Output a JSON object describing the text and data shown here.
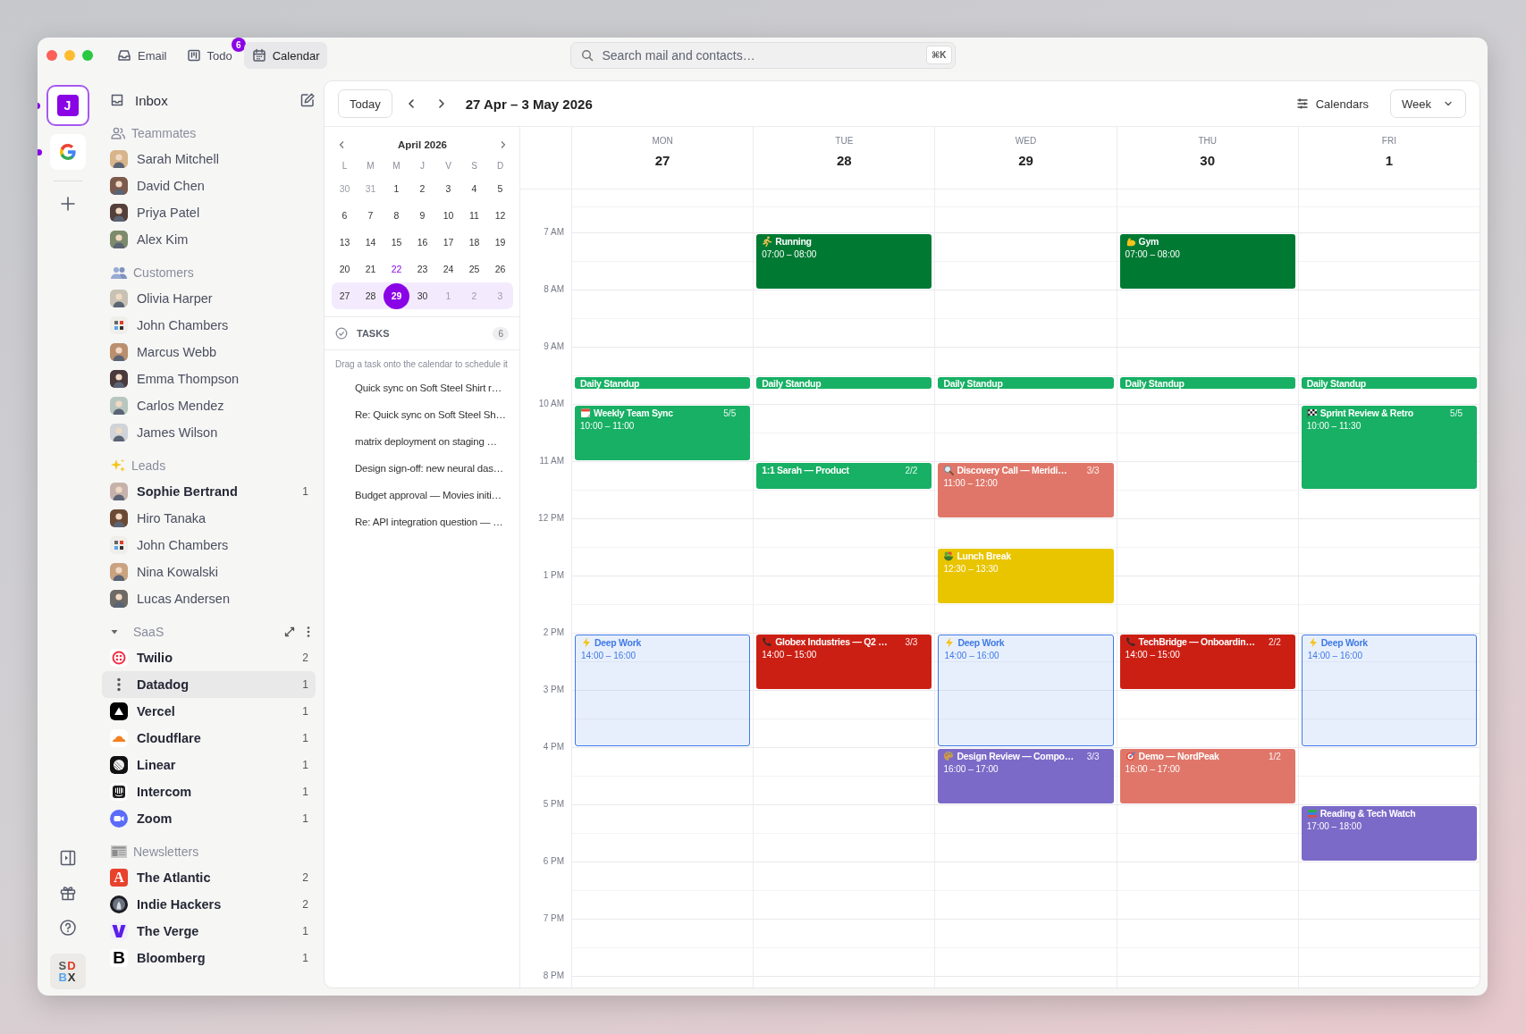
{
  "top_tabs": [
    {
      "label": "Email",
      "selected": false
    },
    {
      "label": "Todo",
      "selected": false,
      "badge": "6"
    },
    {
      "label": "Calendar",
      "selected": true
    }
  ],
  "search": {
    "placeholder": "Search mail and contacts…",
    "shortcut": "⌘K"
  },
  "rail": {
    "accounts": [
      {
        "kind": "letter",
        "label": "J",
        "selected": true,
        "unread": true
      },
      {
        "kind": "google",
        "selected": false,
        "unread": true
      }
    ],
    "workspace_badge": [
      "SD",
      "BX"
    ]
  },
  "sidebar": {
    "inbox": "Inbox",
    "sections": [
      {
        "kind": "teammates",
        "title": "Teammates",
        "items": [
          {
            "kind": "person",
            "name": "Sarah Mitchell",
            "selected": false
          },
          {
            "kind": "person",
            "name": "David Chen",
            "selected": false
          },
          {
            "kind": "person",
            "name": "Priya Patel",
            "selected": false
          },
          {
            "kind": "person",
            "name": "Alex Kim",
            "selected": false
          }
        ]
      },
      {
        "kind": "customers",
        "title": "Customers",
        "items": [
          {
            "kind": "person",
            "name": "Olivia Harper",
            "selected": false
          },
          {
            "kind": "logo",
            "name": "John Chambers",
            "selected": false
          },
          {
            "kind": "person",
            "name": "Marcus Webb",
            "selected": false
          },
          {
            "kind": "person",
            "name": "Emma Thompson",
            "selected": false
          },
          {
            "kind": "person",
            "name": "Carlos Mendez",
            "selected": false
          },
          {
            "kind": "person",
            "name": "James Wilson",
            "selected": false
          }
        ]
      },
      {
        "kind": "leads",
        "title": "Leads",
        "items": [
          {
            "kind": "person",
            "name": "Sophie Bertrand",
            "count": "1",
            "selected": false
          },
          {
            "kind": "person",
            "name": "Hiro Tanaka",
            "selected": false
          },
          {
            "kind": "logo",
            "name": "John Chambers",
            "selected": false
          },
          {
            "kind": "person",
            "name": "Nina Kowalski",
            "selected": false
          },
          {
            "kind": "person",
            "name": "Lucas Andersen",
            "selected": false
          }
        ]
      },
      {
        "kind": "saas",
        "title": "SaaS",
        "toggle": {
          "expanded": true
        },
        "items": [
          {
            "kind": "brand",
            "name": "Twilio",
            "count": "2",
            "selected": false
          },
          {
            "kind": "brand",
            "name": "Datadog",
            "count": "1",
            "selected": true
          },
          {
            "kind": "brand",
            "name": "Vercel",
            "count": "1",
            "selected": false
          },
          {
            "kind": "brand",
            "name": "Cloudflare",
            "count": "1",
            "selected": false
          },
          {
            "kind": "brand",
            "name": "Linear",
            "count": "1",
            "selected": false
          },
          {
            "kind": "brand",
            "name": "Intercom",
            "count": "1",
            "selected": false
          },
          {
            "kind": "brand",
            "name": "Zoom",
            "count": "1",
            "selected": false
          }
        ]
      },
      {
        "kind": "newsletters",
        "title": "Newsletters",
        "items": [
          {
            "kind": "brand",
            "name": "The Atlantic",
            "logo_letter": "A",
            "count": "2",
            "selected": false
          },
          {
            "kind": "brand",
            "name": "Indie Hackers",
            "count": "2",
            "selected": false
          },
          {
            "kind": "brand",
            "name": "The Verge",
            "count": "1",
            "selected": false
          },
          {
            "kind": "brand",
            "name": "Bloomberg",
            "logo_letter": "B",
            "count": "1",
            "selected": false
          }
        ]
      }
    ]
  },
  "toolbar": {
    "today": "Today",
    "range": "27 Apr – 3 May 2026",
    "calendars": "Calendars",
    "view": "Week"
  },
  "mini_calendar": {
    "title": "April 2026",
    "weekdays": [
      "L",
      "M",
      "M",
      "J",
      "V",
      "S",
      "D"
    ],
    "weeks": [
      {
        "in_range": false,
        "days": [
          {
            "label": "30",
            "muted": true,
            "today": false,
            "selected": false
          },
          {
            "label": "31",
            "muted": true,
            "today": false,
            "selected": false
          },
          {
            "label": "1",
            "muted": false,
            "today": false,
            "selected": false
          },
          {
            "label": "2",
            "muted": false,
            "today": false,
            "selected": false
          },
          {
            "label": "3",
            "muted": false,
            "today": false,
            "selected": false
          },
          {
            "label": "4",
            "muted": false,
            "today": false,
            "selected": false
          },
          {
            "label": "5",
            "muted": false,
            "today": false,
            "selected": false
          }
        ]
      },
      {
        "in_range": false,
        "days": [
          {
            "label": "6",
            "muted": false,
            "today": false,
            "selected": false
          },
          {
            "label": "7",
            "muted": false,
            "today": false,
            "selected": false
          },
          {
            "label": "8",
            "muted": false,
            "today": false,
            "selected": false
          },
          {
            "label": "9",
            "muted": false,
            "today": false,
            "selected": false
          },
          {
            "label": "10",
            "muted": false,
            "today": false,
            "selected": false
          },
          {
            "label": "11",
            "muted": false,
            "today": false,
            "selected": false
          },
          {
            "label": "12",
            "muted": false,
            "today": false,
            "selected": false
          }
        ]
      },
      {
        "in_range": false,
        "days": [
          {
            "label": "13",
            "muted": false,
            "today": false,
            "selected": false
          },
          {
            "label": "14",
            "muted": false,
            "today": false,
            "selected": false
          },
          {
            "label": "15",
            "muted": false,
            "today": false,
            "selected": false
          },
          {
            "label": "16",
            "muted": false,
            "today": false,
            "selected": false
          },
          {
            "label": "17",
            "muted": false,
            "today": false,
            "selected": false
          },
          {
            "label": "18",
            "muted": false,
            "today": false,
            "selected": false
          },
          {
            "label": "19",
            "muted": false,
            "today": false,
            "selected": false
          }
        ]
      },
      {
        "in_range": false,
        "days": [
          {
            "label": "20",
            "muted": false,
            "today": false,
            "selected": false
          },
          {
            "label": "21",
            "muted": false,
            "today": false,
            "selected": false
          },
          {
            "label": "22",
            "muted": false,
            "today": true,
            "selected": false
          },
          {
            "label": "23",
            "muted": false,
            "today": false,
            "selected": false
          },
          {
            "label": "24",
            "muted": false,
            "today": false,
            "selected": false
          },
          {
            "label": "25",
            "muted": false,
            "today": false,
            "selected": false
          },
          {
            "label": "26",
            "muted": false,
            "today": false,
            "selected": false
          }
        ]
      },
      {
        "in_range": true,
        "days": [
          {
            "label": "27",
            "muted": false,
            "today": false,
            "selected": false
          },
          {
            "label": "28",
            "muted": false,
            "today": false,
            "selected": false
          },
          {
            "label": "29",
            "muted": false,
            "today": false,
            "selected": true
          },
          {
            "label": "30",
            "muted": false,
            "today": false,
            "selected": false
          },
          {
            "label": "1",
            "muted": true,
            "today": false,
            "selected": false
          },
          {
            "label": "2",
            "muted": true,
            "today": false,
            "selected": false
          },
          {
            "label": "3",
            "muted": true,
            "today": false,
            "selected": false
          }
        ]
      }
    ]
  },
  "tasks": {
    "title": "TASKS",
    "count": "6",
    "hint": "Drag a task onto the calendar to schedule it",
    "items": [
      "Quick sync on Soft Steel Shirt r…",
      "Re: Quick sync on Soft Steel Sh…",
      "matrix deployment on staging …",
      "Design sign-off: new neural das…",
      "Budget approval — Movies initi…",
      "Re: API integration question — …"
    ]
  },
  "week": {
    "hours": [
      "7 AM",
      "8 AM",
      "9 AM",
      "10 AM",
      "11 AM",
      "12 PM",
      "1 PM",
      "2 PM",
      "3 PM",
      "4 PM",
      "5 PM",
      "6 PM",
      "7 PM",
      "8 PM"
    ],
    "days": [
      {
        "weekday": "MON",
        "date": "27",
        "events": [
          {
            "kind": "solid",
            "title": "Daily Standup",
            "placed_at": {
              "09:30-09:45": true
            },
            "color": "#17b064"
          },
          {
            "kind": "solid",
            "title": "Weekly Team Sync",
            "count": "5/5",
            "time": "10:00 – 11:00",
            "color": "#17b064"
          },
          {
            "kind": "outline",
            "title": "Deep Work",
            "time": "14:00 – 16:00",
            "color": "#3f7ae6"
          }
        ]
      },
      {
        "weekday": "TUE",
        "date": "28",
        "events": [
          {
            "kind": "solid",
            "title": "Running",
            "time": "07:00 – 08:00",
            "color": "#007a33"
          },
          {
            "kind": "solid",
            "title": "Daily Standup",
            "placed_at": {
              "09:30-09:45": true
            },
            "color": "#17b064"
          },
          {
            "kind": "solid",
            "title": "1:1 Sarah — Product",
            "count": "2/2",
            "placed_at": {
              "11:00-11:30": true
            },
            "color": "#17b064"
          },
          {
            "kind": "solid",
            "title": "Globex Industries — Q2 …",
            "count": "3/3",
            "time": "14:00 – 15:00",
            "color": "#cc1f14"
          }
        ]
      },
      {
        "weekday": "WED",
        "date": "29",
        "events": [
          {
            "kind": "solid",
            "title": "Daily Standup",
            "placed_at": {
              "09:30-09:45": true
            },
            "color": "#17b064"
          },
          {
            "kind": "solid",
            "title": "Discovery Call — Meridi…",
            "count": "3/3",
            "time": "11:00 – 12:00",
            "color": "#e07669"
          },
          {
            "kind": "solid",
            "title": "Lunch Break",
            "time": "12:30 – 13:30",
            "color": "#e9c500"
          },
          {
            "kind": "outline",
            "title": "Deep Work",
            "time": "14:00 – 16:00",
            "color": "#3f7ae6"
          },
          {
            "kind": "solid",
            "title": "Design Review — Compo…",
            "count": "3/3",
            "time": "16:00 – 17:00",
            "color": "#7b6ac8"
          }
        ]
      },
      {
        "weekday": "THU",
        "date": "30",
        "events": [
          {
            "kind": "solid",
            "title": "Gym",
            "time": "07:00 – 08:00",
            "color": "#007a33"
          },
          {
            "kind": "solid",
            "title": "Daily Standup",
            "placed_at": {
              "09:30-09:45": true
            },
            "color": "#17b064"
          },
          {
            "kind": "solid",
            "title": "TechBridge — Onboardin…",
            "count": "2/2",
            "time": "14:00 – 15:00",
            "color": "#cc1f14"
          },
          {
            "kind": "solid",
            "title": "Demo — NordPeak",
            "count": "1/2",
            "time": "16:00 – 17:00",
            "color": "#e07669"
          }
        ]
      },
      {
        "weekday": "FRI",
        "date": "1",
        "events": [
          {
            "kind": "solid",
            "title": "Daily Standup",
            "placed_at": {
              "09:30-09:45": true
            },
            "color": "#17b064"
          },
          {
            "kind": "solid",
            "title": "Sprint Review & Retro",
            "count": "5/5",
            "time": "10:00 – 11:30",
            "color": "#17b064"
          },
          {
            "kind": "outline",
            "title": "Deep Work",
            "time": "14:00 – 16:00",
            "color": "#3f7ae6"
          },
          {
            "kind": "solid",
            "title": "Reading & Tech Watch",
            "time": "17:00 – 18:00",
            "color": "#7b6ac8"
          }
        ]
      }
    ]
  }
}
